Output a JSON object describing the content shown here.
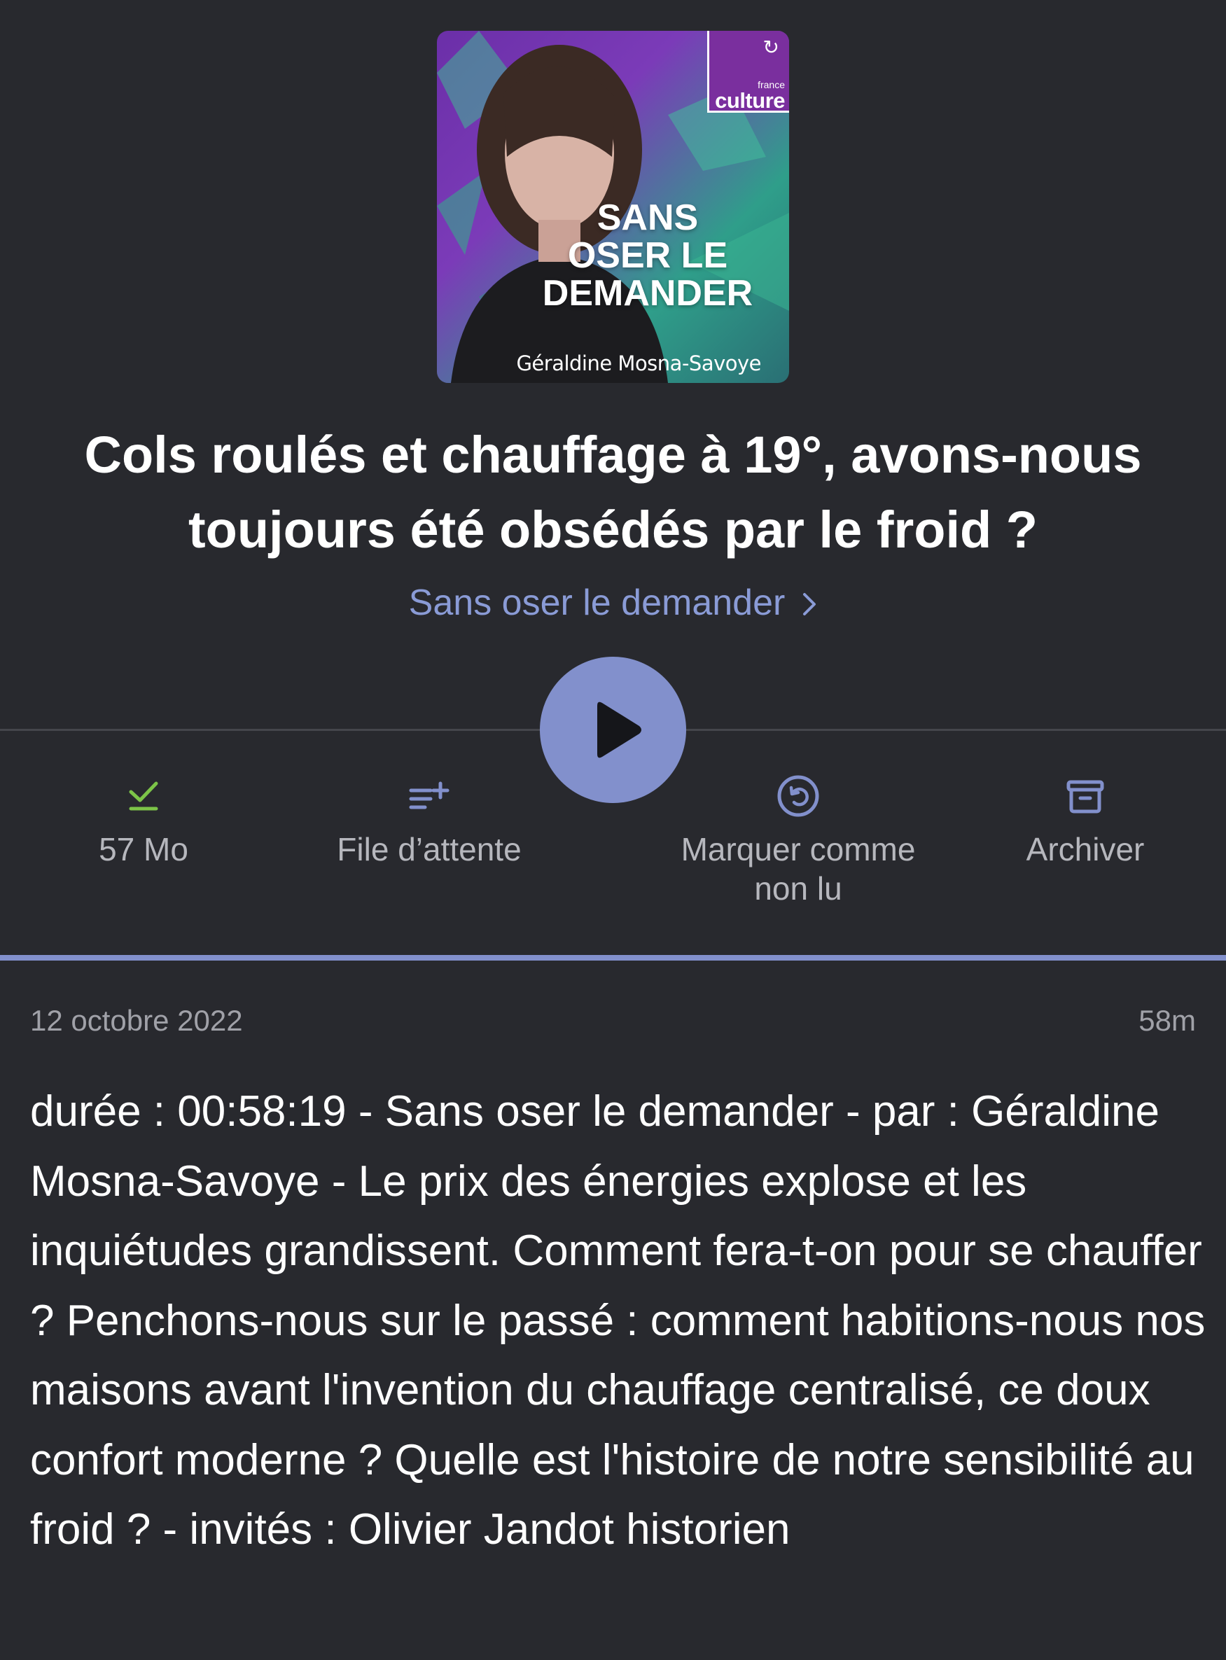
{
  "artwork": {
    "badge_small": "france",
    "badge_name": "culture",
    "show_title": "SANS\nOSER LE\nDEMANDER",
    "author": "Géraldine Mosna-Savoye"
  },
  "episode": {
    "title": "Cols roulés et chauffage à 19°, avons-nous toujours été obsédés par le froid ?",
    "podcast_name": "Sans oser le demander"
  },
  "actions": {
    "download_label": "57 Mo",
    "queue_label": "File d’attente",
    "unread_label": "Marquer comme non lu",
    "archive_label": "Archiver"
  },
  "icons": {
    "download": "check-icon",
    "queue": "queue-add-icon",
    "unread": "mark-unread-icon",
    "archive": "archive-icon",
    "play": "play-icon",
    "chevron": "chevron-right-icon"
  },
  "colors": {
    "background": "#28292e",
    "accent": "#8290cc",
    "link": "#8a9bd6",
    "downloaded": "#7cc448",
    "secondary_text": "#b6b7bd"
  },
  "meta": {
    "date": "12 octobre 2022",
    "duration": "58m"
  },
  "description": "durée : 00:58:19 - Sans oser le demander - par : Géraldine Mosna-Savoye - Le prix des énergies explose et les inquiétudes grandissent. Comment fera-t-on pour se chauffer ? Penchons-nous sur le passé : comment habitions-nous nos maisons avant l'invention du chauffage centralisé, ce doux confort moderne ? Quelle est l'histoire de notre sensibilité au froid ? - invités : Olivier Jandot historien"
}
